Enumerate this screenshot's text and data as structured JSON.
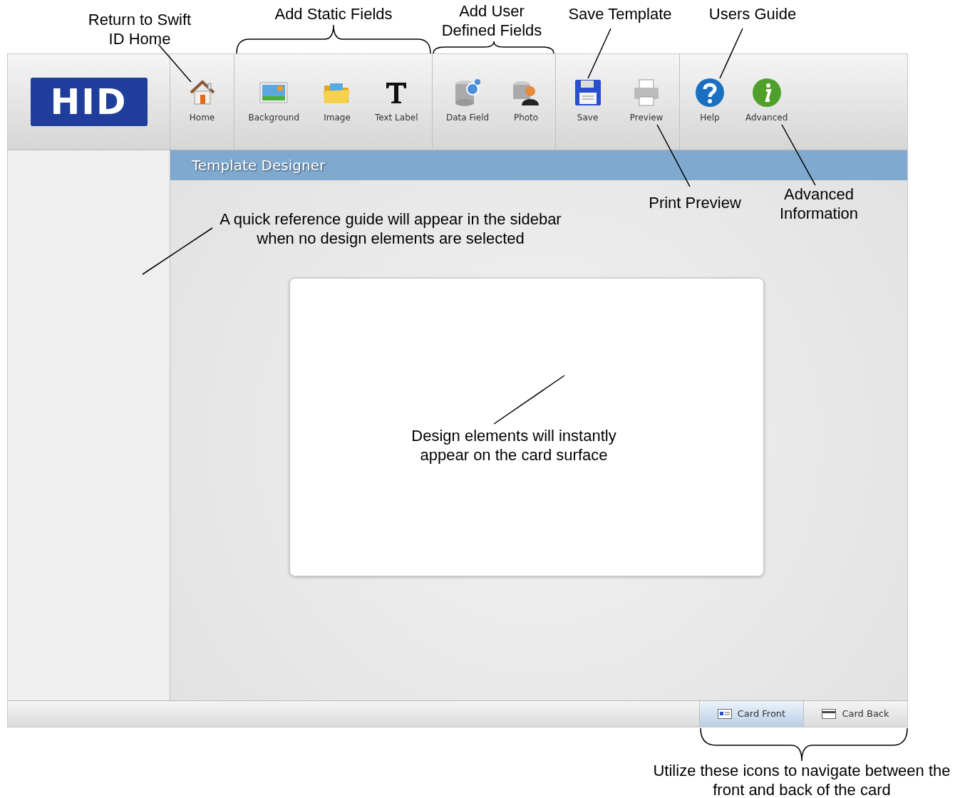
{
  "toolbar": {
    "logo": "HID",
    "groups": [
      {
        "items": [
          {
            "label": "Home",
            "kind": "home"
          }
        ]
      },
      {
        "items": [
          {
            "label": "Background",
            "kind": "background"
          },
          {
            "label": "Image",
            "kind": "folder"
          },
          {
            "label": "Text Label",
            "kind": "text"
          }
        ]
      },
      {
        "items": [
          {
            "label": "Data Field",
            "kind": "database"
          },
          {
            "label": "Photo",
            "kind": "person"
          }
        ]
      },
      {
        "items": [
          {
            "label": "Save",
            "kind": "save"
          },
          {
            "label": "Preview",
            "kind": "printer"
          }
        ]
      },
      {
        "items": [
          {
            "label": "Help",
            "kind": "help"
          },
          {
            "label": "Advanced",
            "kind": "info"
          }
        ]
      }
    ]
  },
  "title_bar": "Template Designer",
  "card_tabs": [
    {
      "label": "Card Front",
      "kind": "front",
      "selected": true
    },
    {
      "label": "Card Back",
      "kind": "back",
      "selected": false
    }
  ],
  "annotations": [
    {
      "text": "Return to Swift ID Home"
    },
    {
      "text": "Add Static Fields"
    },
    {
      "text": "Add User Defined Fields"
    },
    {
      "text": "Save Template"
    },
    {
      "text": "Users Guide"
    },
    {
      "text": "Print Preview"
    },
    {
      "text": "Advanced Information"
    },
    {
      "text": "A quick reference guide will appear in the sidebar when no design elements are selected"
    },
    {
      "text": "Design elements will instantly appear on the card surface"
    },
    {
      "text": "Utilize these icons to navigate between the front and back of the card"
    }
  ]
}
